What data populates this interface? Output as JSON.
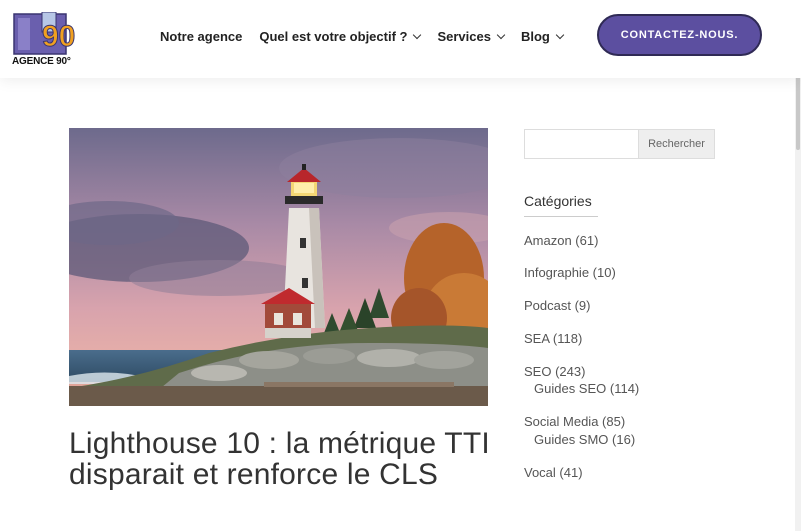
{
  "header": {
    "logo_number": "90",
    "logo_text": "AGENCE 90°",
    "nav": [
      {
        "label": "Notre agence",
        "has_dropdown": false
      },
      {
        "label": "Quel est votre objectif ?",
        "has_dropdown": true
      },
      {
        "label": "Services",
        "has_dropdown": true
      },
      {
        "label": "Blog",
        "has_dropdown": true
      }
    ],
    "cta_label": "CONTACTEZ-NOUS."
  },
  "post": {
    "title": "Lighthouse 10 : la métrique TTI disparait et renforce le CLS"
  },
  "sidebar": {
    "search_placeholder": "",
    "search_button": "Rechercher",
    "categories_title": "Catégories",
    "categories": [
      {
        "label": "Amazon (61)",
        "level": 0
      },
      {
        "label": "Infographie (10)",
        "level": 0
      },
      {
        "label": "Podcast (9)",
        "level": 0
      },
      {
        "label": "SEA (118)",
        "level": 0
      },
      {
        "label": "SEO (243)",
        "level": 0
      },
      {
        "label": "Guides SEO (114)",
        "level": 1
      },
      {
        "label": "Social Media (85)",
        "level": 0
      },
      {
        "label": "Guides SMO (16)",
        "level": 1
      },
      {
        "label": "Vocal (41)",
        "level": 0
      }
    ]
  },
  "colors": {
    "cta_background": "#5c4fa0",
    "logo_orange": "#f0a020",
    "logo_purple": "#5c4fa0"
  }
}
